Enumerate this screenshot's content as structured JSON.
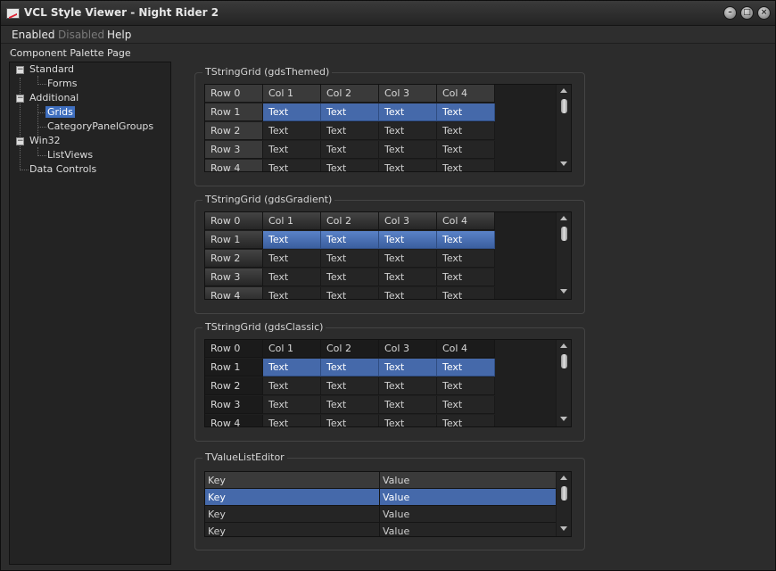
{
  "window": {
    "title": "VCL Style Viewer - Night Rider 2",
    "icon": "app-icon",
    "controls": [
      "minimize-icon",
      "maximize-icon",
      "close-icon"
    ]
  },
  "menu": [
    {
      "label": "Enabled",
      "disabled": false
    },
    {
      "label": "Disabled",
      "disabled": true
    },
    {
      "label": "Help",
      "disabled": false
    }
  ],
  "palette_label": "Component Palette Page",
  "tree": {
    "nodes": [
      {
        "label": "Standard",
        "level": 0,
        "expanded": true
      },
      {
        "label": "Forms",
        "level": 1
      },
      {
        "label": "Additional",
        "level": 0,
        "expanded": true
      },
      {
        "label": "Grids",
        "level": 1,
        "selected": true
      },
      {
        "label": "CategoryPanelGroups",
        "level": 1
      },
      {
        "label": "Win32",
        "level": 0,
        "expanded": true
      },
      {
        "label": "ListViews",
        "level": 1
      },
      {
        "label": "Data Controls",
        "level": 0
      }
    ]
  },
  "grids": [
    {
      "title": "TStringGrid (gdsThemed)",
      "headers": [
        "Row 0",
        "Col 1",
        "Col 2",
        "Col 3",
        "Col 4"
      ],
      "rows": [
        [
          "Row 1",
          "Text",
          "Text",
          "Text",
          "Text"
        ],
        [
          "Row 2",
          "Text",
          "Text",
          "Text",
          "Text"
        ],
        [
          "Row 3",
          "Text",
          "Text",
          "Text",
          "Text"
        ],
        [
          "Row 4",
          "Text",
          "Text",
          "Text",
          "Text"
        ]
      ],
      "selected_row": 1
    },
    {
      "title": "TStringGrid (gdsGradient)",
      "headers": [
        "Row 0",
        "Col 1",
        "Col 2",
        "Col 3",
        "Col 4"
      ],
      "rows": [
        [
          "Row 1",
          "Text",
          "Text",
          "Text",
          "Text"
        ],
        [
          "Row 2",
          "Text",
          "Text",
          "Text",
          "Text"
        ],
        [
          "Row 3",
          "Text",
          "Text",
          "Text",
          "Text"
        ],
        [
          "Row 4",
          "Text",
          "Text",
          "Text",
          "Text"
        ]
      ],
      "selected_row": 1
    },
    {
      "title": "TStringGrid (gdsClassic)",
      "headers": [
        "Row 0",
        "Col 1",
        "Col 2",
        "Col 3",
        "Col 4"
      ],
      "rows": [
        [
          "Row 1",
          "Text",
          "Text",
          "Text",
          "Text"
        ],
        [
          "Row 2",
          "Text",
          "Text",
          "Text",
          "Text"
        ],
        [
          "Row 3",
          "Text",
          "Text",
          "Text",
          "Text"
        ],
        [
          "Row 4",
          "Text",
          "Text",
          "Text",
          "Text"
        ]
      ],
      "selected_row": 1
    }
  ],
  "value_list": {
    "title": "TValueListEditor",
    "headers": [
      "Key",
      "Value"
    ],
    "rows": [
      [
        "Key",
        "Value"
      ],
      [
        "Key",
        "Value"
      ],
      [
        "Key",
        "Value"
      ]
    ],
    "selected_row": 1
  }
}
